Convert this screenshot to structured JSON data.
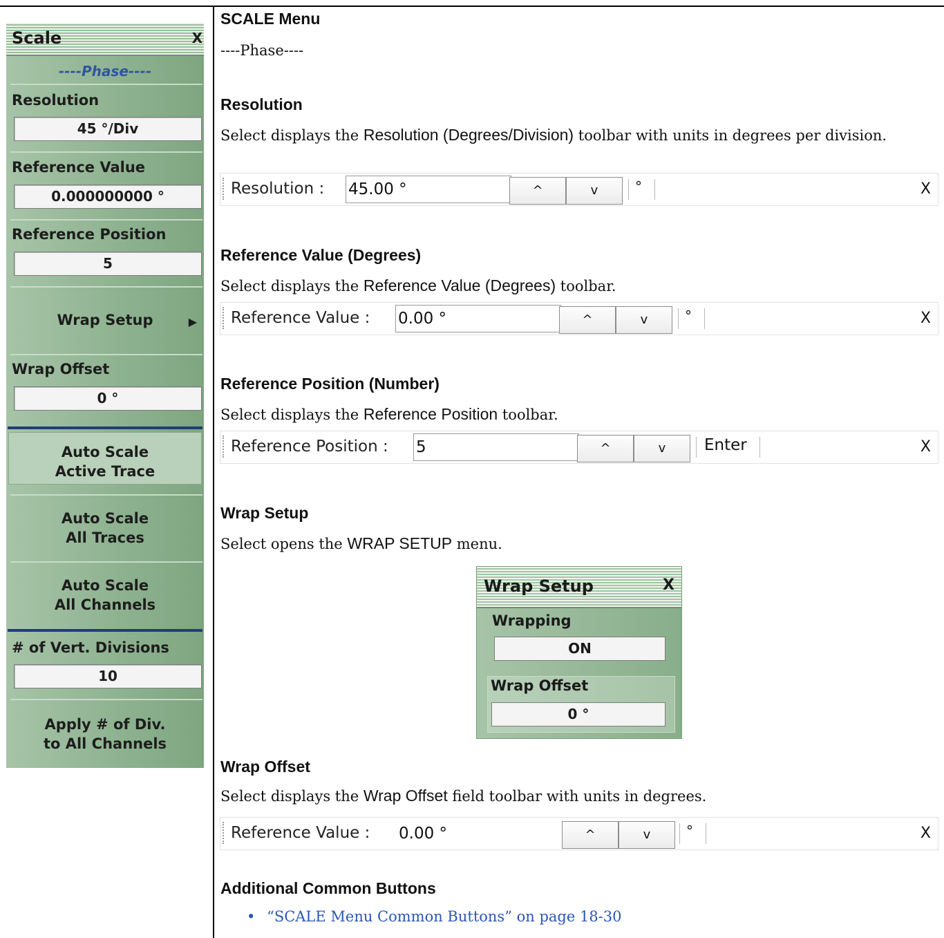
{
  "scale_panel": {
    "title": "Scale",
    "close": "X",
    "phase_header": "----Phase----",
    "resolution_label": "Resolution",
    "resolution_value": "45 °/Div",
    "ref_value_label": "Reference Value",
    "ref_value_value": "0.000000000 °",
    "ref_pos_label": "Reference Position",
    "ref_pos_value": "5",
    "wrap_setup_button": "Wrap Setup",
    "wrap_offset_label": "Wrap Offset",
    "wrap_offset_value": "0 °",
    "auto_scale_active": [
      "Auto Scale",
      "Active Trace"
    ],
    "auto_scale_all_traces": [
      "Auto Scale",
      "All Traces"
    ],
    "auto_scale_all_channels": [
      "Auto Scale",
      "All Channels"
    ],
    "vert_div_label": "# of Vert. Divisions",
    "vert_div_value": "10",
    "apply_div": [
      "Apply # of Div.",
      "to All Channels"
    ]
  },
  "doc": {
    "menu_title": "SCALE Menu",
    "phase_line": "----Phase----",
    "resolution": {
      "heading": "Resolution",
      "text_pre": "Select displays the ",
      "text_key": "Resolution (Degrees/Division)",
      "text_post": " toolbar with units in degrees per division."
    },
    "ref_value": {
      "heading": "Reference Value (Degrees)",
      "text_pre": "Select displays the ",
      "text_key": "Reference Value (Degrees)",
      "text_post": " toolbar."
    },
    "ref_pos": {
      "heading": "Reference Position (Number)",
      "text_pre": "Select displays the ",
      "text_key": "Reference Position",
      "text_post": " toolbar."
    },
    "wrap_setup": {
      "heading": "Wrap Setup",
      "text_pre": "Select opens the ",
      "text_key": "WRAP SETUP",
      "text_post": " menu."
    },
    "wrap_offset": {
      "heading": "Wrap Offset",
      "text_pre": "Select displays the ",
      "text_key": "Wrap Offset",
      "text_post": " field toolbar with units in degrees."
    },
    "common": {
      "heading": "Additional Common Buttons",
      "bullet": "•",
      "link": "“SCALE Menu Common Buttons” on page 18-30"
    }
  },
  "toolbars": {
    "resolution": {
      "label": "Resolution  :",
      "value": "45.00 °",
      "unit": "°",
      "close": "X"
    },
    "ref_value": {
      "label": "Reference Value  :",
      "value": "0.00 °",
      "unit": "°",
      "close": "X"
    },
    "ref_pos": {
      "label": "Reference Position  :",
      "value": "5",
      "unit": "Enter",
      "close": "X"
    },
    "wrap_offset": {
      "label": "Reference Value  :",
      "value": "0.00 °",
      "unit": "°",
      "close": "X"
    },
    "up_glyph": "^",
    "down_glyph": "v"
  },
  "wrap_dialog": {
    "title": "Wrap Setup",
    "close": "X",
    "wrapping_label": "Wrapping",
    "wrapping_value": "ON",
    "offset_label": "Wrap Offset",
    "offset_value": "0 °"
  }
}
